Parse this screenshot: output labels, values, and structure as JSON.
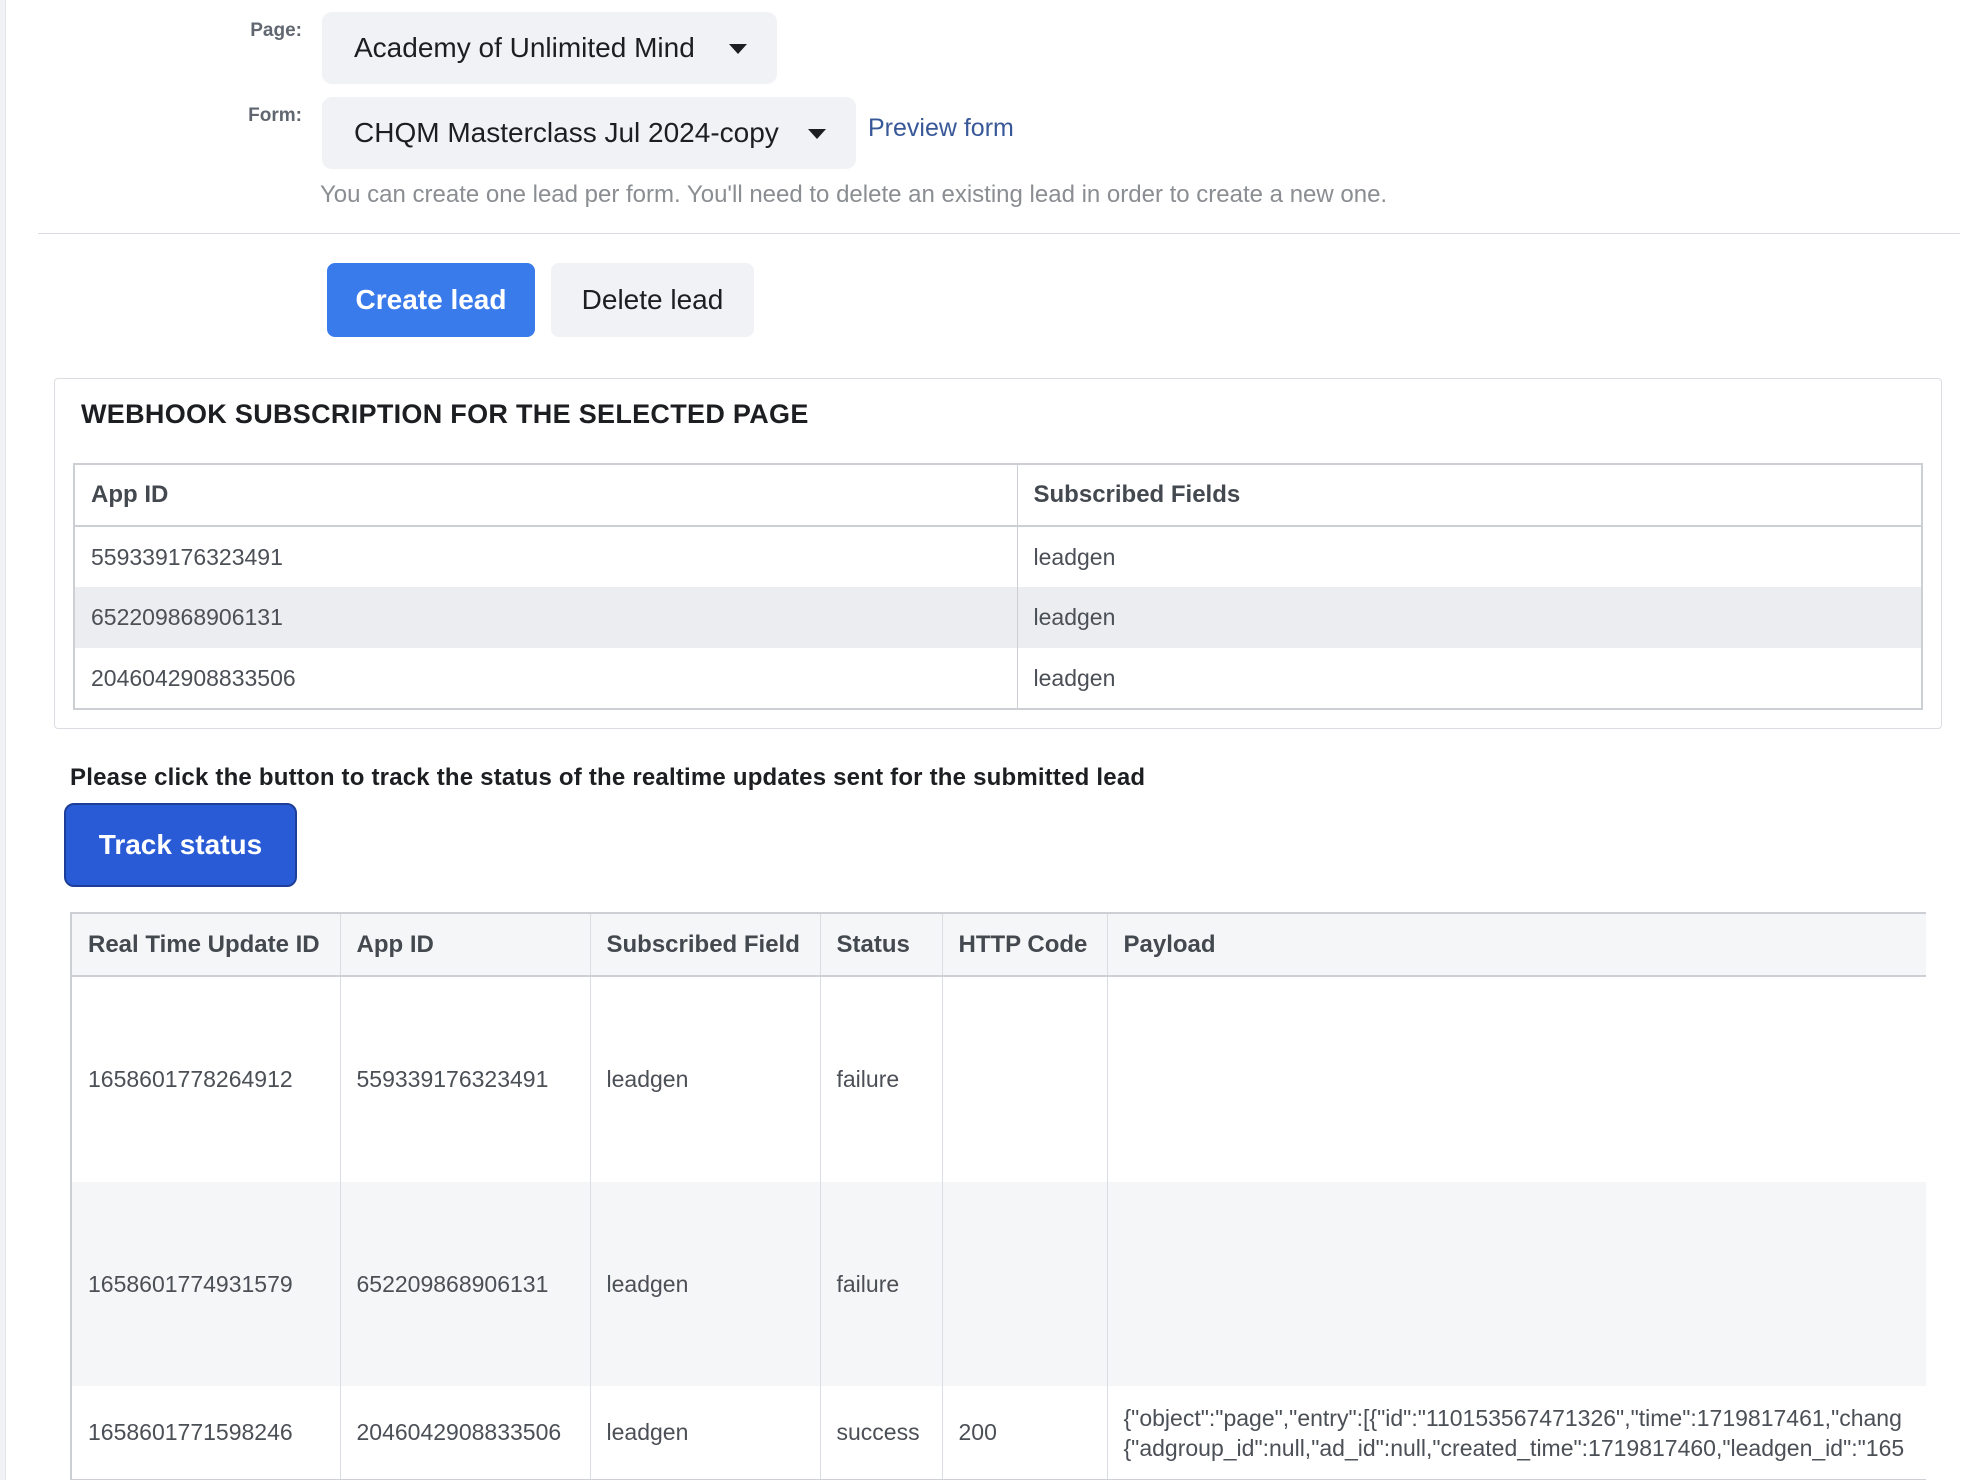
{
  "form_section": {
    "page_label": "Page:",
    "page_value": "Academy of Unlimited Mind",
    "form_label": "Form:",
    "form_value": "CHQM Masterclass Jul 2024-copy",
    "preview_link": "Preview form",
    "help_text": "You can create one lead per form. You'll need to delete an existing lead in order to create a new one."
  },
  "actions": {
    "create_label": "Create lead",
    "delete_label": "Delete lead"
  },
  "webhook": {
    "title": "WEBHOOK SUBSCRIPTION FOR THE SELECTED PAGE",
    "columns": [
      "App ID",
      "Subscribed Fields"
    ],
    "rows": [
      {
        "app_id": "559339176323491",
        "fields": "leadgen"
      },
      {
        "app_id": "652209868906131",
        "fields": "leadgen"
      },
      {
        "app_id": "2046042908833506",
        "fields": "leadgen"
      }
    ]
  },
  "tracking": {
    "instruction": "Please click the button to track the status of the realtime updates sent for the submitted lead",
    "track_label": "Track status"
  },
  "rtu_table": {
    "columns": [
      "Real Time Update ID",
      "App ID",
      "Subscribed Field",
      "Status",
      "HTTP Code",
      "Payload"
    ],
    "rows": [
      {
        "id": "1658601778264912",
        "app_id": "559339176323491",
        "field": "leadgen",
        "status": "failure",
        "http_code": "",
        "payload_1": "",
        "payload_2": ""
      },
      {
        "id": "1658601774931579",
        "app_id": "652209868906131",
        "field": "leadgen",
        "status": "failure",
        "http_code": "",
        "payload_1": "",
        "payload_2": ""
      },
      {
        "id": "1658601771598246",
        "app_id": "2046042908833506",
        "field": "leadgen",
        "status": "success",
        "http_code": "200",
        "payload_1": "{\"object\":\"page\",\"entry\":[{\"id\":\"110153567471326\",\"time\":1719817461,\"chang",
        "payload_2": "{\"adgroup_id\":null,\"ad_id\":null,\"created_time\":1719817460,\"leadgen_id\":\"165"
      }
    ]
  }
}
